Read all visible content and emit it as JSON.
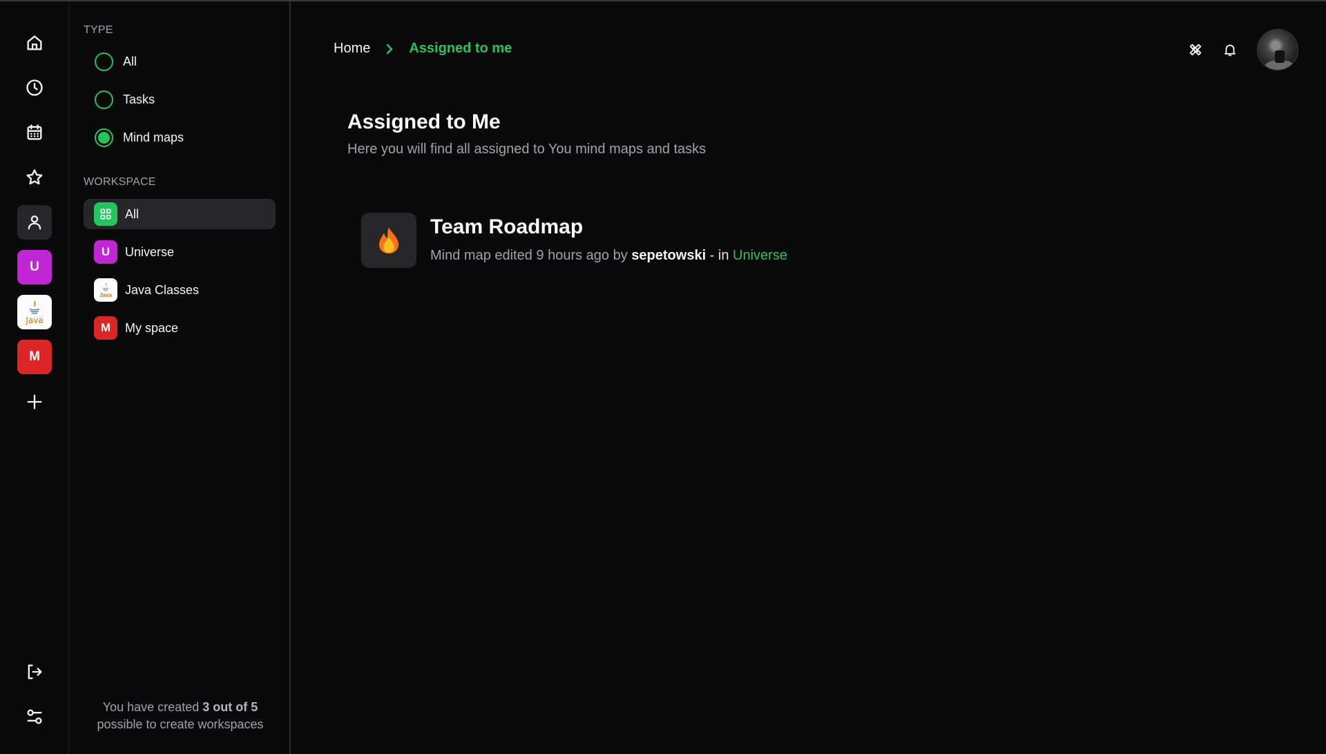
{
  "rail": {
    "nav": [
      {
        "name": "home",
        "icon": "home-icon"
      },
      {
        "name": "recent",
        "icon": "clock-icon"
      },
      {
        "name": "calendar",
        "icon": "calendar-icon"
      },
      {
        "name": "favorites",
        "icon": "star-icon"
      },
      {
        "name": "assigned-to-me",
        "icon": "user-icon",
        "active": true
      }
    ],
    "workspaces": [
      {
        "initial": "U",
        "name": "Universe",
        "color": "#c026d3"
      },
      {
        "initial": "",
        "name": "Java Classes",
        "logo_text": "Java"
      },
      {
        "initial": "M",
        "name": "My space",
        "color": "#dc2626"
      }
    ],
    "add_icon": "plus-icon",
    "logout_icon": "logout-icon",
    "settings_icon": "settings-sliders-icon"
  },
  "filter": {
    "type_label": "TYPE",
    "types": [
      {
        "label": "All",
        "selected": false
      },
      {
        "label": "Tasks",
        "selected": false
      },
      {
        "label": "Mind maps",
        "selected": true
      }
    ],
    "workspace_label": "WORKSPACE",
    "workspaces": [
      {
        "label": "All",
        "icon": "grid-icon",
        "color": "#22c55e",
        "active": true
      },
      {
        "label": "Universe",
        "initial": "U",
        "color": "#c026d3"
      },
      {
        "label": "Java Classes",
        "logo_text": "Java"
      },
      {
        "label": "My space",
        "initial": "M",
        "color": "#dc2626"
      }
    ],
    "quota": {
      "prefix": "You have created ",
      "count": "3 out of 5",
      "suffix": "possible to create workspaces"
    }
  },
  "header": {
    "breadcrumb": {
      "home": "Home",
      "current": "Assigned to me"
    },
    "actions": [
      "tools-icon",
      "bell-icon",
      "avatar"
    ]
  },
  "main": {
    "title": "Assigned to Me",
    "subtitle": "Here you will find all assigned to You mind maps and tasks",
    "items": [
      {
        "title": "Team Roadmap",
        "icon": "fire-icon",
        "meta_prefix": "Mind map edited 9 hours ago by ",
        "author": "sepetowski",
        "meta_sep": " - in ",
        "workspace": "Universe"
      }
    ]
  },
  "colors": {
    "accent": "#22c55e",
    "background": "#0b0a0a",
    "surface": "#27272a",
    "muted_text": "#a1a1aa"
  }
}
